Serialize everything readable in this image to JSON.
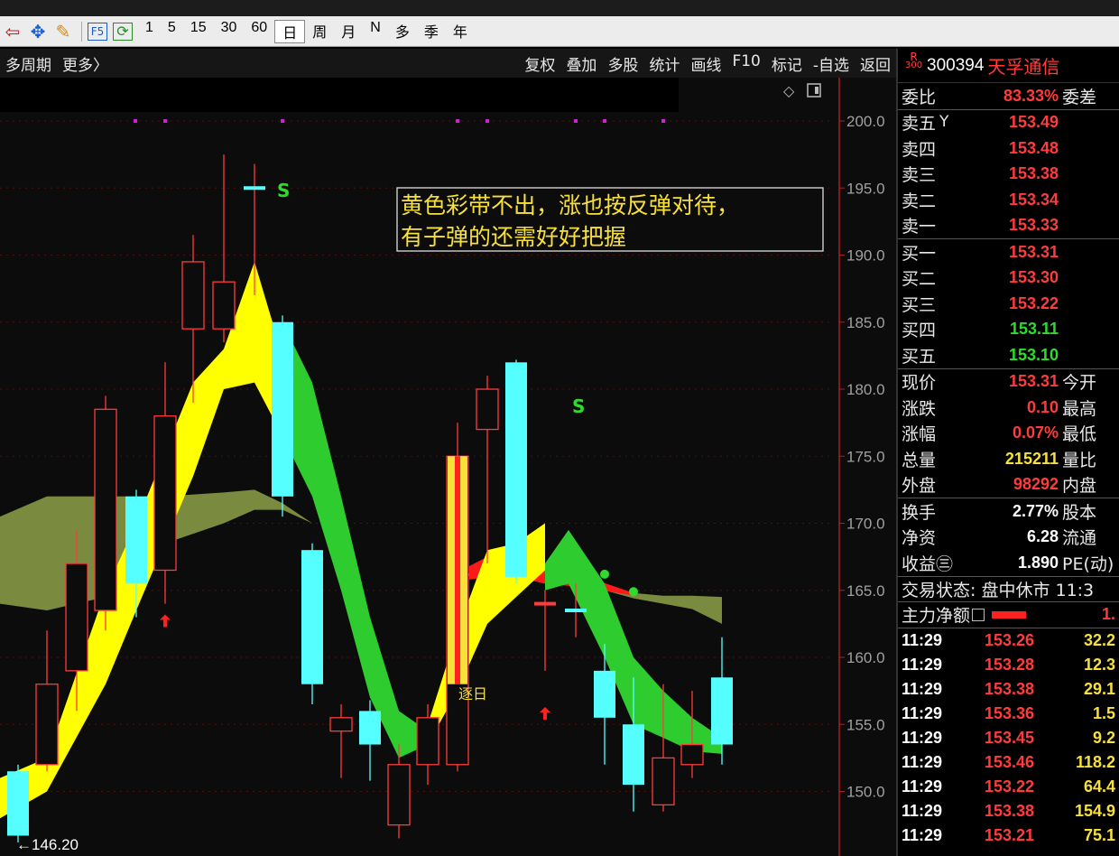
{
  "toolbar": {
    "periods": [
      "1",
      "5",
      "15",
      "30",
      "60",
      "日",
      "周",
      "月",
      "N",
      "多",
      "季",
      "年"
    ],
    "active_period": "日"
  },
  "chart_menu": {
    "left": [
      "多周期",
      "更多〉"
    ],
    "right": [
      "复权",
      "叠加",
      "多股",
      "统计",
      "画线",
      "F10",
      "标记",
      "-自选",
      "返回"
    ]
  },
  "chart": {
    "price_ticks": [
      "200.0",
      "195.0",
      "190.0",
      "185.0",
      "180.0",
      "175.0",
      "170.0",
      "165.0",
      "160.0",
      "155.0",
      "150.0"
    ],
    "annotation_line1": "黄色彩带不出，涨也按反弹对待，",
    "annotation_line2": "有子弹的还需好好把握",
    "s_marker_1": "S",
    "s_marker_2": "S",
    "daily_label": "逐日",
    "low_label": "←146.20",
    "colors": {
      "up": "#ff3b3b",
      "down": "#55ffff",
      "yellow_band": "#ffff00",
      "green_band": "#2ecc2e",
      "olive_band": "#7a8a3e",
      "red_band": "#ff1a1a"
    }
  },
  "chart_data": {
    "type": "candlestick",
    "ylim": [
      145,
      202
    ],
    "candles": [
      {
        "o": 151.5,
        "c": 146.7,
        "h": 152.0,
        "l": 146.2,
        "dir": "down"
      },
      {
        "o": 152.0,
        "c": 158.0,
        "h": 162.0,
        "l": 151.5,
        "dir": "up"
      },
      {
        "o": 159.0,
        "c": 167.0,
        "h": 169.5,
        "l": 156.0,
        "dir": "up"
      },
      {
        "o": 163.5,
        "c": 178.5,
        "h": 179.5,
        "l": 162.0,
        "dir": "up"
      },
      {
        "o": 172.0,
        "c": 165.5,
        "h": 172.5,
        "l": 163.0,
        "dir": "down"
      },
      {
        "o": 166.5,
        "c": 178.0,
        "h": 182.0,
        "l": 164.0,
        "dir": "up"
      },
      {
        "o": 184.5,
        "c": 189.5,
        "h": 191.5,
        "l": 179.0,
        "dir": "up"
      },
      {
        "o": 184.5,
        "c": 188.0,
        "h": 197.5,
        "l": 183.5,
        "dir": "up"
      },
      {
        "o": 195.0,
        "c": 195.0,
        "h": 196.8,
        "l": 187.0,
        "dir": "flat"
      },
      {
        "o": 185.0,
        "c": 172.0,
        "h": 185.5,
        "l": 170.5,
        "dir": "down"
      },
      {
        "o": 168.0,
        "c": 158.0,
        "h": 168.5,
        "l": 156.5,
        "dir": "down"
      },
      {
        "o": 154.5,
        "c": 155.5,
        "h": 156.5,
        "l": 151.0,
        "dir": "up"
      },
      {
        "o": 156.0,
        "c": 153.5,
        "h": 156.8,
        "l": 150.8,
        "dir": "down"
      },
      {
        "o": 147.5,
        "c": 152.0,
        "h": 153.5,
        "l": 146.5,
        "dir": "up"
      },
      {
        "o": 152.0,
        "c": 155.5,
        "h": 156.5,
        "l": 150.5,
        "dir": "up"
      },
      {
        "o": 152.0,
        "c": 175.0,
        "h": 177.5,
        "l": 151.5,
        "dir": "up"
      },
      {
        "o": 177.0,
        "c": 180.0,
        "h": 181.0,
        "l": 167.0,
        "dir": "up"
      },
      {
        "o": 182.0,
        "c": 166.0,
        "h": 182.2,
        "l": 165.5,
        "dir": "down"
      },
      {
        "o": 164.0,
        "c": 164.0,
        "h": 165.0,
        "l": 159.0,
        "dir": "flat"
      },
      {
        "o": 163.5,
        "c": 163.5,
        "h": 165.5,
        "l": 161.5,
        "dir": "flat"
      },
      {
        "o": 159.0,
        "c": 155.5,
        "h": 161.0,
        "l": 152.0,
        "dir": "down"
      },
      {
        "o": 155.0,
        "c": 150.5,
        "h": 158.5,
        "l": 148.5,
        "dir": "down"
      },
      {
        "o": 149.0,
        "c": 152.5,
        "h": 158.0,
        "l": 148.5,
        "dir": "up"
      },
      {
        "o": 152.0,
        "c": 153.5,
        "h": 157.5,
        "l": 151.0,
        "dir": "up"
      },
      {
        "o": 153.5,
        "c": 158.5,
        "h": 161.5,
        "l": 152.0,
        "dir": "down"
      }
    ]
  },
  "quote": {
    "r_tag_top": "R",
    "r_tag_bottom": "300",
    "code": "300394",
    "name": "天孚通信",
    "weibi_label": "委比",
    "weibi_value": "83.33%",
    "weicha_label": "委差",
    "sells": [
      {
        "label": "卖五",
        "price": "153.49"
      },
      {
        "label": "卖四",
        "price": "153.48"
      },
      {
        "label": "卖三",
        "price": "153.38"
      },
      {
        "label": "卖二",
        "price": "153.34"
      },
      {
        "label": "卖一",
        "price": "153.33"
      }
    ],
    "sell5_mark": "Y",
    "buys": [
      {
        "label": "买一",
        "price": "153.31",
        "color": "red"
      },
      {
        "label": "买二",
        "price": "153.30",
        "color": "red"
      },
      {
        "label": "买三",
        "price": "153.22",
        "color": "red"
      },
      {
        "label": "买四",
        "price": "153.11",
        "color": "grn"
      },
      {
        "label": "买五",
        "price": "153.10",
        "color": "grn"
      }
    ],
    "stats": [
      {
        "label": "现价",
        "value": "153.31",
        "color": "red",
        "label2": "今开"
      },
      {
        "label": "涨跌",
        "value": "0.10",
        "color": "red",
        "label2": "最高"
      },
      {
        "label": "涨幅",
        "value": "0.07%",
        "color": "red",
        "label2": "最低"
      },
      {
        "label": "总量",
        "value": "215211",
        "color": "yel",
        "label2": "量比"
      },
      {
        "label": "外盘",
        "value": "98292",
        "color": "red",
        "label2": "内盘"
      }
    ],
    "stats2": [
      {
        "label": "换手",
        "value": "2.77%",
        "color": "wht",
        "label2": "股本"
      },
      {
        "label": "净资",
        "value": "6.28",
        "color": "wht",
        "label2": "流通"
      },
      {
        "label": "收益㊂",
        "value": "1.890",
        "color": "wht",
        "label2": "PE(动)"
      }
    ],
    "trade_status": "交易状态: 盘中休市 11:3",
    "main_net_label": "主力净额",
    "main_net_value": "1.",
    "ticks": [
      {
        "time": "11:29",
        "price": "153.26",
        "vol": "32.2"
      },
      {
        "time": "11:29",
        "price": "153.28",
        "vol": "12.3"
      },
      {
        "time": "11:29",
        "price": "153.38",
        "vol": "29.1"
      },
      {
        "time": "11:29",
        "price": "153.36",
        "vol": "1.5"
      },
      {
        "time": "11:29",
        "price": "153.45",
        "vol": "9.2"
      },
      {
        "time": "11:29",
        "price": "153.46",
        "vol": "118.2"
      },
      {
        "time": "11:29",
        "price": "153.22",
        "vol": "64.4"
      },
      {
        "time": "11:29",
        "price": "153.38",
        "vol": "154.9"
      },
      {
        "time": "11:29",
        "price": "153.21",
        "vol": "75.1"
      }
    ]
  }
}
